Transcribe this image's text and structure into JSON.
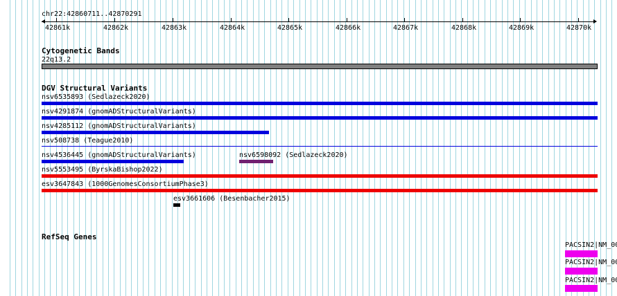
{
  "ruler": {
    "location": "chr22:42860711..42870291",
    "ticks": [
      "42861k",
      "42862k",
      "42863k",
      "42864k",
      "42865k",
      "42866k",
      "42867k",
      "42868k",
      "42869k",
      "42870k"
    ]
  },
  "cytoband_track": {
    "title": "Cytogenetic Bands",
    "band_label": "22q13.2",
    "band_color": "#808080"
  },
  "dgv_track": {
    "title": "DGV Structural Variants",
    "features": [
      {
        "label": "nsv6535893 (Sedlazeck2020)",
        "color": "#0000dd"
      },
      {
        "label": "nsv4291874 (gnomADStructuralVariants)",
        "color": "#0000dd"
      },
      {
        "label": "nsv4285112 (gnomADStructuralVariants)",
        "color": "#0000dd"
      },
      {
        "label": "nsv508738 (Teague2010)",
        "color": "#0000dd"
      },
      {
        "label": "nsv4536445 (gnomADStructuralVariants)",
        "color": "#0000dd"
      },
      {
        "label": "nsv6598092 (Sedlazeck2020)",
        "color": "#702070"
      },
      {
        "label": "nsv5553495 (ByrskaBishop2022)",
        "color": "#ee0000"
      },
      {
        "label": "esv3647843 (1000GenomesConsortiumPhase3)",
        "color": "#ee0000"
      },
      {
        "label": "esv3661606 (Besenbacher2015)",
        "color": "#000000"
      }
    ]
  },
  "refseq_track": {
    "title": "RefSeq Genes",
    "features": [
      {
        "label": "PACSIN2|NM_00",
        "color": "#ee00ee"
      },
      {
        "label": "PACSIN2|NM_00",
        "color": "#ee00ee"
      },
      {
        "label": "PACSIN2|NM_00",
        "color": "#ee00ee"
      }
    ]
  },
  "colors": {
    "grid_line": "#9fd6e0",
    "background": "#ffffff"
  }
}
